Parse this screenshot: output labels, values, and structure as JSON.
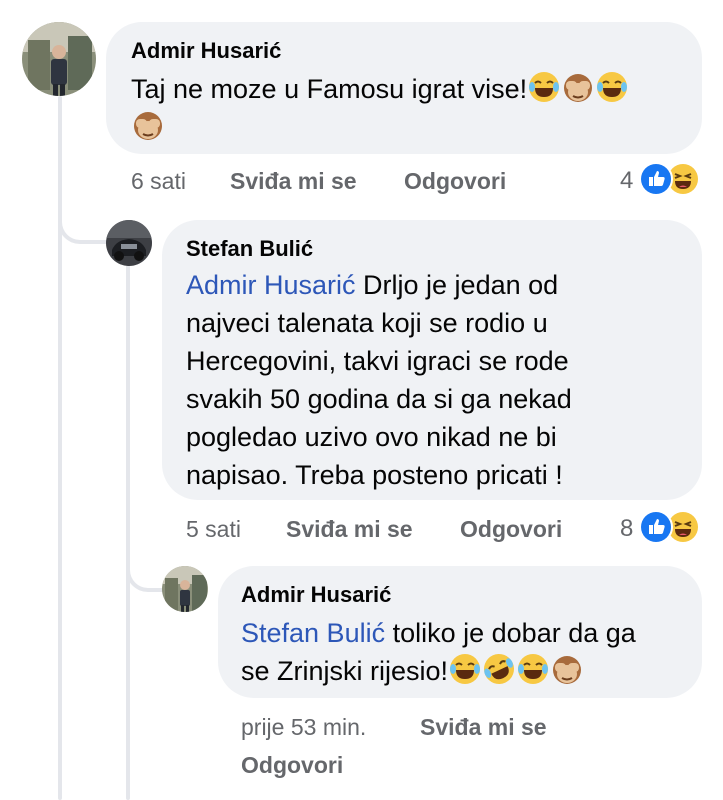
{
  "comments": [
    {
      "author": "Admir Husarić",
      "lines": [
        "Taj ne moze u Famosu igrat vise!"
      ],
      "time": "6 sati",
      "like_label": "Sviđa mi se",
      "reply_label": "Odgovori",
      "reaction_count": "4",
      "reactions": [
        "like-icon",
        "laugh-icon"
      ]
    },
    {
      "author": "Stefan Bulić",
      "mention": "Admir Husarić",
      "lines": [
        " Drljo je jedan od",
        "najveci talenata koji se rodio u",
        "Hercegovini, takvi igraci se rode",
        "svakih 50 godina da si ga nekad",
        "pogledao uzivo ovo nikad ne bi",
        "napisao. Treba posteno pricati !"
      ],
      "time": "5 sati",
      "like_label": "Sviđa mi se",
      "reply_label": "Odgovori",
      "reaction_count": "8",
      "reactions": [
        "like-icon",
        "laugh-icon"
      ]
    },
    {
      "author": "Admir Husarić",
      "mention": "Stefan Bulić",
      "lines": [
        " toliko je dobar da ga",
        "se Zrinjski rijesio!"
      ],
      "time": "prije 53 min.",
      "like_label": "Sviđa mi se",
      "reply_label": "Odgovori"
    }
  ],
  "colors": {
    "bubble": "#f0f2f5",
    "mention": "#2d57b8",
    "meta": "#65676b",
    "like_blue": "#1877f2",
    "emoji_yellow": "#f7c843"
  }
}
